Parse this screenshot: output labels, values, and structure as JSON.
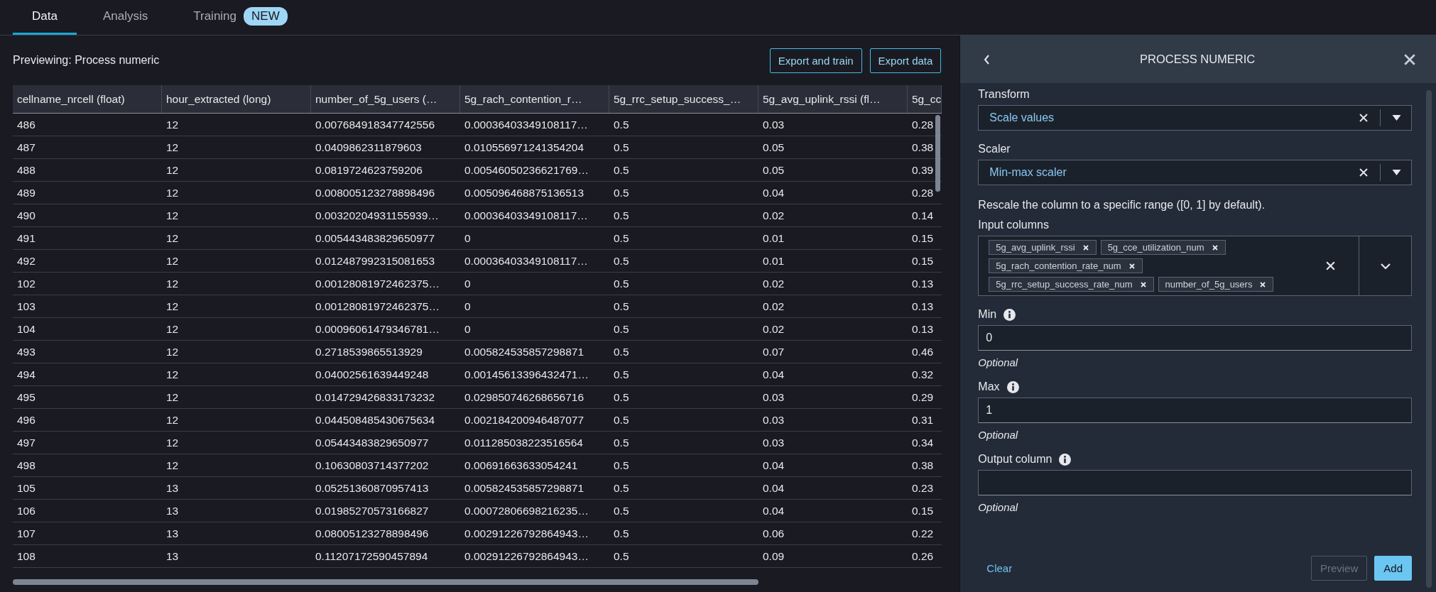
{
  "tabs": [
    {
      "label": "Data",
      "selected": true
    },
    {
      "label": "Analysis",
      "selected": false
    },
    {
      "label": "Training",
      "selected": false,
      "badge": "NEW"
    }
  ],
  "preview": {
    "title": "Previewing: Process numeric",
    "buttons": [
      "Export and train",
      "Export data"
    ]
  },
  "table": {
    "columns": [
      "cellname_nrcell (float)",
      "hour_extracted (long)",
      "number_of_5g_users (…",
      "5g_rach_contention_r…",
      "5g_rrc_setup_success_…",
      "5g_avg_uplink_rssi (fl…",
      "5g_cc"
    ],
    "rows": [
      [
        "486",
        "12",
        "0.007684918347742556",
        "0.00036403349108117…",
        "0.5",
        "0.03",
        "0.28"
      ],
      [
        "487",
        "12",
        "0.0409862311879603",
        "0.010556971241354204",
        "0.5",
        "0.05",
        "0.38"
      ],
      [
        "488",
        "12",
        "0.0819724623759206",
        "0.00546050236621769…",
        "0.5",
        "0.05",
        "0.39"
      ],
      [
        "489",
        "12",
        "0.008005123278898496",
        "0.005096468875136513",
        "0.5",
        "0.04",
        "0.28"
      ],
      [
        "490",
        "12",
        "0.00320204931155939…",
        "0.00036403349108117…",
        "0.5",
        "0.02",
        "0.14"
      ],
      [
        "491",
        "12",
        "0.005443483829650977",
        "0",
        "0.5",
        "0.01",
        "0.15"
      ],
      [
        "492",
        "12",
        "0.012487992315081653",
        "0.00036403349108117…",
        "0.5",
        "0.01",
        "0.15"
      ],
      [
        "102",
        "12",
        "0.00128081972462375…",
        "0",
        "0.5",
        "0.02",
        "0.13"
      ],
      [
        "103",
        "12",
        "0.00128081972462375…",
        "0",
        "0.5",
        "0.02",
        "0.13"
      ],
      [
        "104",
        "12",
        "0.00096061479346781…",
        "0",
        "0.5",
        "0.02",
        "0.13"
      ],
      [
        "493",
        "12",
        "0.2718539865513929",
        "0.005824535857298871",
        "0.5",
        "0.07",
        "0.46"
      ],
      [
        "494",
        "12",
        "0.04002561639449248",
        "0.00145613396432471…",
        "0.5",
        "0.04",
        "0.32"
      ],
      [
        "495",
        "12",
        "0.014729426833173232",
        "0.029850746268656716",
        "0.5",
        "0.03",
        "0.29"
      ],
      [
        "496",
        "12",
        "0.044508485430675634",
        "0.002184200946487077",
        "0.5",
        "0.03",
        "0.31"
      ],
      [
        "497",
        "12",
        "0.05443483829650977",
        "0.011285038223516564",
        "0.5",
        "0.03",
        "0.34"
      ],
      [
        "498",
        "12",
        "0.10630803714377202",
        "0.00691663633054241",
        "0.5",
        "0.04",
        "0.38"
      ],
      [
        "105",
        "13",
        "0.05251360870957413",
        "0.005824535857298871",
        "0.5",
        "0.04",
        "0.23"
      ],
      [
        "106",
        "13",
        "0.01985270573166827",
        "0.00072806698216235…",
        "0.5",
        "0.04",
        "0.15"
      ],
      [
        "107",
        "13",
        "0.08005123278898496",
        "0.00291226792864943…",
        "0.5",
        "0.06",
        "0.22"
      ],
      [
        "108",
        "13",
        "0.11207172590457894",
        "0.00291226792864943…",
        "0.5",
        "0.09",
        "0.26"
      ]
    ]
  },
  "panel": {
    "title": "PROCESS NUMERIC",
    "fields": [
      {
        "kind": "select",
        "label": "Transform",
        "value": "Scale values"
      },
      {
        "kind": "select",
        "label": "Scaler",
        "value": "Min-max scaler"
      },
      {
        "kind": "note",
        "text": "Rescale the column to a specific range ([0, 1] by default)."
      },
      {
        "kind": "multiselect",
        "label": "Input columns",
        "tokens": [
          "5g_avg_uplink_rssi",
          "5g_cce_utilization_num",
          "5g_rach_contention_rate_num",
          "5g_rrc_setup_success_rate_num",
          "number_of_5g_users"
        ]
      },
      {
        "kind": "input",
        "label": "Min",
        "info": true,
        "value": "0",
        "hint": "Optional"
      },
      {
        "kind": "input",
        "label": "Max",
        "info": true,
        "value": "1",
        "hint": "Optional"
      },
      {
        "kind": "input",
        "label": "Output column",
        "info": true,
        "hint": "Optional"
      }
    ],
    "buttons": [
      {
        "label": "Clear",
        "kind": "link",
        "disabled": false
      },
      {
        "label": "Preview",
        "kind": "secondary",
        "disabled": true
      },
      {
        "label": "Add",
        "kind": "primary",
        "disabled": false
      }
    ]
  }
}
